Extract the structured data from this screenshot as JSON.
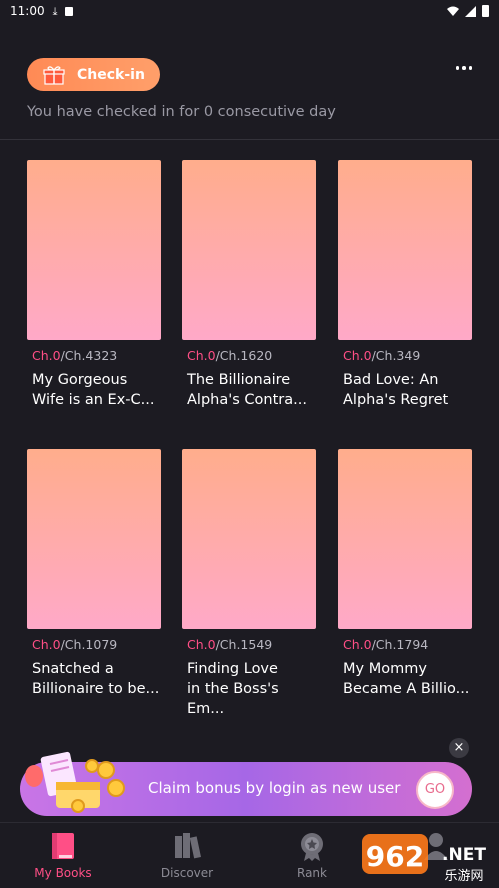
{
  "status_bar": {
    "time": "11:00"
  },
  "header": {
    "checkin_label": "Check-in",
    "checkin_status": "You have checked in for 0 consecutive day"
  },
  "books": [
    {
      "current_chapter": "Ch.0",
      "total_chapters": "/Ch.4323",
      "title": "My Gorgeous\nWife is an Ex-C..."
    },
    {
      "current_chapter": "Ch.0",
      "total_chapters": "/Ch.1620",
      "title": "The Billionaire\nAlpha's Contra..."
    },
    {
      "current_chapter": "Ch.0",
      "total_chapters": "/Ch.349",
      "title": "Bad Love: An\nAlpha's Regret"
    },
    {
      "current_chapter": "Ch.0",
      "total_chapters": "/Ch.1079",
      "title": "Snatched a\nBillionaire to be..."
    },
    {
      "current_chapter": "Ch.0",
      "total_chapters": "/Ch.1549",
      "title": "Finding Love\nin the Boss's Em..."
    },
    {
      "current_chapter": "Ch.0",
      "total_chapters": "/Ch.1794",
      "title": "My Mommy\nBecame A Billio..."
    }
  ],
  "banner": {
    "text": "Claim bonus by login as new user",
    "go_label": "GO",
    "close_label": "×"
  },
  "nav": [
    {
      "label": "My Books",
      "icon": "book-icon",
      "active": true
    },
    {
      "label": "Discover",
      "icon": "bookshelf-icon",
      "active": false
    },
    {
      "label": "Rank",
      "icon": "medal-icon",
      "active": false
    },
    {
      "label": "",
      "icon": "profile-icon",
      "active": false
    }
  ],
  "watermark": {
    "text": "962.NET",
    "subtext": "乐游网"
  },
  "colors": {
    "accent": "#ff4f86",
    "checkin": "#ff8a55",
    "background": "#1c1b22"
  }
}
